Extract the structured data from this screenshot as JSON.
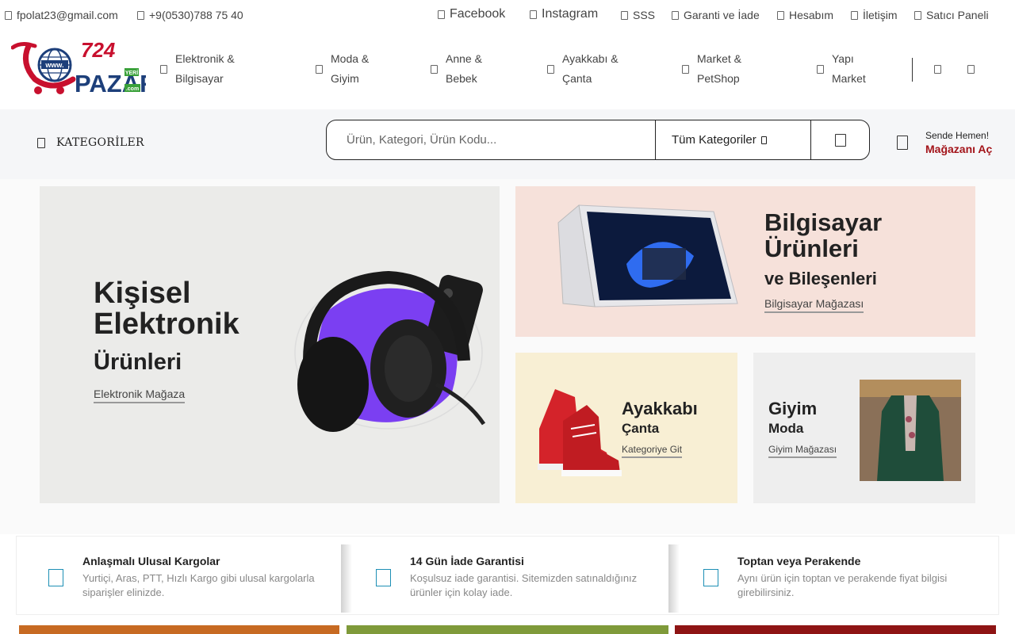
{
  "topbar": {
    "email": "fpolat23@gmail.com",
    "phone": "+9(0530)788 75 40",
    "links": [
      "Facebook",
      "Instagram",
      "SSS",
      "Garanti ve İade",
      "Hesabım",
      "İletişim",
      "Satıcı Paneli"
    ]
  },
  "logo": {
    "number": "724",
    "word": "PAZAR",
    "small": "YERİ",
    "www": "www.",
    "dotcom": ".com"
  },
  "nav": [
    {
      "label": "Elektronik &\nBilgisayar"
    },
    {
      "label": "Moda &\nGiyim"
    },
    {
      "label": "Anne &\nBebek"
    },
    {
      "label": "Ayakkabı &\nÇanta"
    },
    {
      "label": "Market &\nPetShop"
    },
    {
      "label": "Yapı\nMarket"
    }
  ],
  "search": {
    "categories_label": "KATEGORİLER",
    "placeholder": "Ürün, Kategori, Ürün Kodu...",
    "category_select": "Tüm Kategoriler",
    "store_line1": "Sende Hemen!",
    "store_line2": "Mağazanı Aç"
  },
  "promos": {
    "electronics": {
      "title1": "Kişisel",
      "title2": "Elektronik",
      "subtitle": "Ürünleri",
      "link": "Elektronik Mağaza"
    },
    "computer": {
      "title1": "Bilgisayar",
      "title2": "Ürünleri",
      "subtitle": "ve Bileşenleri",
      "link": "Bilgisayar Mağazası"
    },
    "shoes": {
      "title": "Ayakkabı",
      "subtitle": "Çanta",
      "link": "Kategoriye Git"
    },
    "clothing": {
      "title": "Giyim",
      "subtitle": "Moda",
      "link": "Giyim Mağazası"
    }
  },
  "features": [
    {
      "title": "Anlaşmalı Ulusal Kargolar",
      "desc": "Yurtiçi, Aras, PTT, Hızlı Kargo gibi ulusal kargolarla siparişler elinizde."
    },
    {
      "title": "14 Gün İade Garantisi",
      "desc": "Koşulsuz iade garantisi. Sitemizden satınaldığınız ürünler için kolay iade."
    },
    {
      "title": "Toptan veya Perakende",
      "desc": "Aynı ürün için toptan ve perakende fiyat bilgisi girebilirsiniz."
    }
  ],
  "colors": {
    "brand_red": "#c8102e",
    "brand_blue": "#1d3f7a",
    "store_red": "#a3141a",
    "feature_icon": "#1d8fb5"
  },
  "icons": [
    "mail-icon",
    "phone-icon",
    "facebook-icon",
    "instagram-icon",
    "help-icon",
    "shield-icon",
    "user-icon",
    "chat-icon",
    "store-icon",
    "heart-icon",
    "cart-icon",
    "menu-icon",
    "search-icon",
    "chevron-down-icon",
    "truck-icon",
    "return-icon",
    "box-icon"
  ]
}
